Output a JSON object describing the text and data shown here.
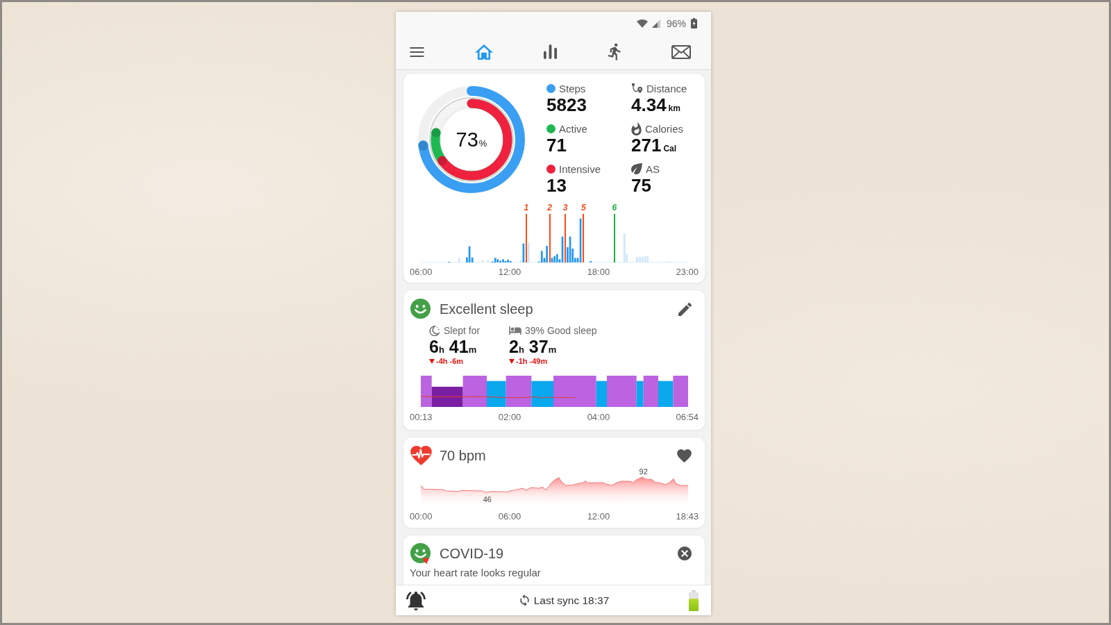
{
  "status_bar": {
    "battery": "96%"
  },
  "nav": {
    "tabs": [
      {
        "kind": "menu",
        "selected": false
      },
      {
        "kind": "home",
        "selected": true
      },
      {
        "kind": "stats",
        "selected": false
      },
      {
        "kind": "workouts",
        "selected": false
      },
      {
        "kind": "messages",
        "selected": false
      }
    ]
  },
  "activity": {
    "goal": {
      "value": "73",
      "unit": "%"
    },
    "metrics": [
      {
        "label": "Steps",
        "value": "5823",
        "color": "#3a9ff2"
      },
      {
        "label": "Active",
        "value": "71",
        "color": "#1eb853"
      },
      {
        "label": "Intensive",
        "value": "13",
        "color": "#f0213f"
      }
    ],
    "stats": [
      {
        "kind": "distance",
        "label": "Distance",
        "value": "4.34",
        "unit": "km"
      },
      {
        "kind": "calories",
        "label": "Calories",
        "value": "271",
        "unit": "Cal"
      },
      {
        "kind": "score",
        "label": "AS",
        "value": "75"
      }
    ],
    "timeline": {
      "markers": [
        {
          "label": "1",
          "color": "#ff4a14"
        },
        {
          "label": "2",
          "color": "#ff4a14"
        },
        {
          "label": "3",
          "color": "#ff4a14"
        },
        {
          "label": "5",
          "color": "#ff4a14"
        },
        {
          "label": "6",
          "color": "#19b33c"
        }
      ],
      "axis_labels": [
        "06:00",
        "12:00",
        "18:00",
        "23:00"
      ]
    }
  },
  "sleep": {
    "title": "Excellent sleep",
    "stats": [
      {
        "kind": "duration",
        "label": "Slept for",
        "parts": [
          {
            "number": "6",
            "unit": "h"
          },
          {
            "number": "41",
            "unit": "m"
          }
        ],
        "change": "-4h -6m",
        "decreased": true
      },
      {
        "kind": "quality",
        "label": "39% Good sleep",
        "parts": [
          {
            "number": "2",
            "unit": "h"
          },
          {
            "number": "37",
            "unit": "m"
          }
        ],
        "change": "-1h -49m",
        "decreased": true
      }
    ],
    "axis_labels": [
      "00:13",
      "02:00",
      "04:00",
      "06:54"
    ]
  },
  "heart_rate": {
    "title": "70 bpm",
    "peaks": [
      {
        "kind": "max",
        "label": "92"
      },
      {
        "kind": "min",
        "label": "46"
      }
    ],
    "axis_labels": [
      "00:00",
      "06:00",
      "12:00",
      "18:43"
    ]
  },
  "covid": {
    "title": "COVID-19",
    "message": "Your heart rate looks regular"
  },
  "footer": {
    "sync": "Last sync 18:37"
  }
}
